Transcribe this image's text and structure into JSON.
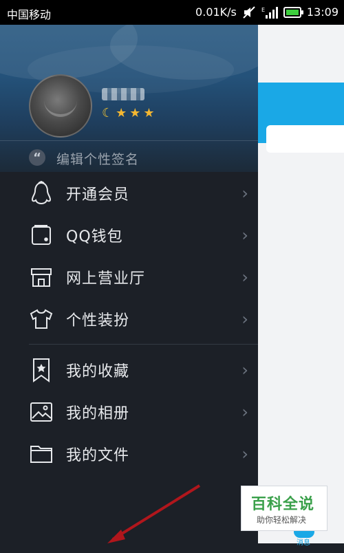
{
  "status_bar": {
    "carrier": "中国移动",
    "speed": "0.01K/s",
    "time": "13:09"
  },
  "profile": {
    "signature_placeholder": "编辑个性签名"
  },
  "menu": {
    "items": [
      {
        "label": "开通会员",
        "icon": "penguin-icon"
      },
      {
        "label": "QQ钱包",
        "icon": "wallet-icon"
      },
      {
        "label": "网上营业厅",
        "icon": "store-icon"
      },
      {
        "label": "个性装扮",
        "icon": "tshirt-icon"
      },
      {
        "label": "我的收藏",
        "icon": "bookmark-star-icon"
      },
      {
        "label": "我的相册",
        "icon": "photo-icon"
      },
      {
        "label": "我的文件",
        "icon": "folder-icon"
      }
    ]
  },
  "background_panel": {
    "tab_label": "消息"
  },
  "watermark": {
    "title": "百科全说",
    "subtitle": "助你轻松解决"
  },
  "colors": {
    "drawer_bg": "#1c2027",
    "accent_blue": "#1aa8e6",
    "watermark_green": "#3aa04a"
  }
}
